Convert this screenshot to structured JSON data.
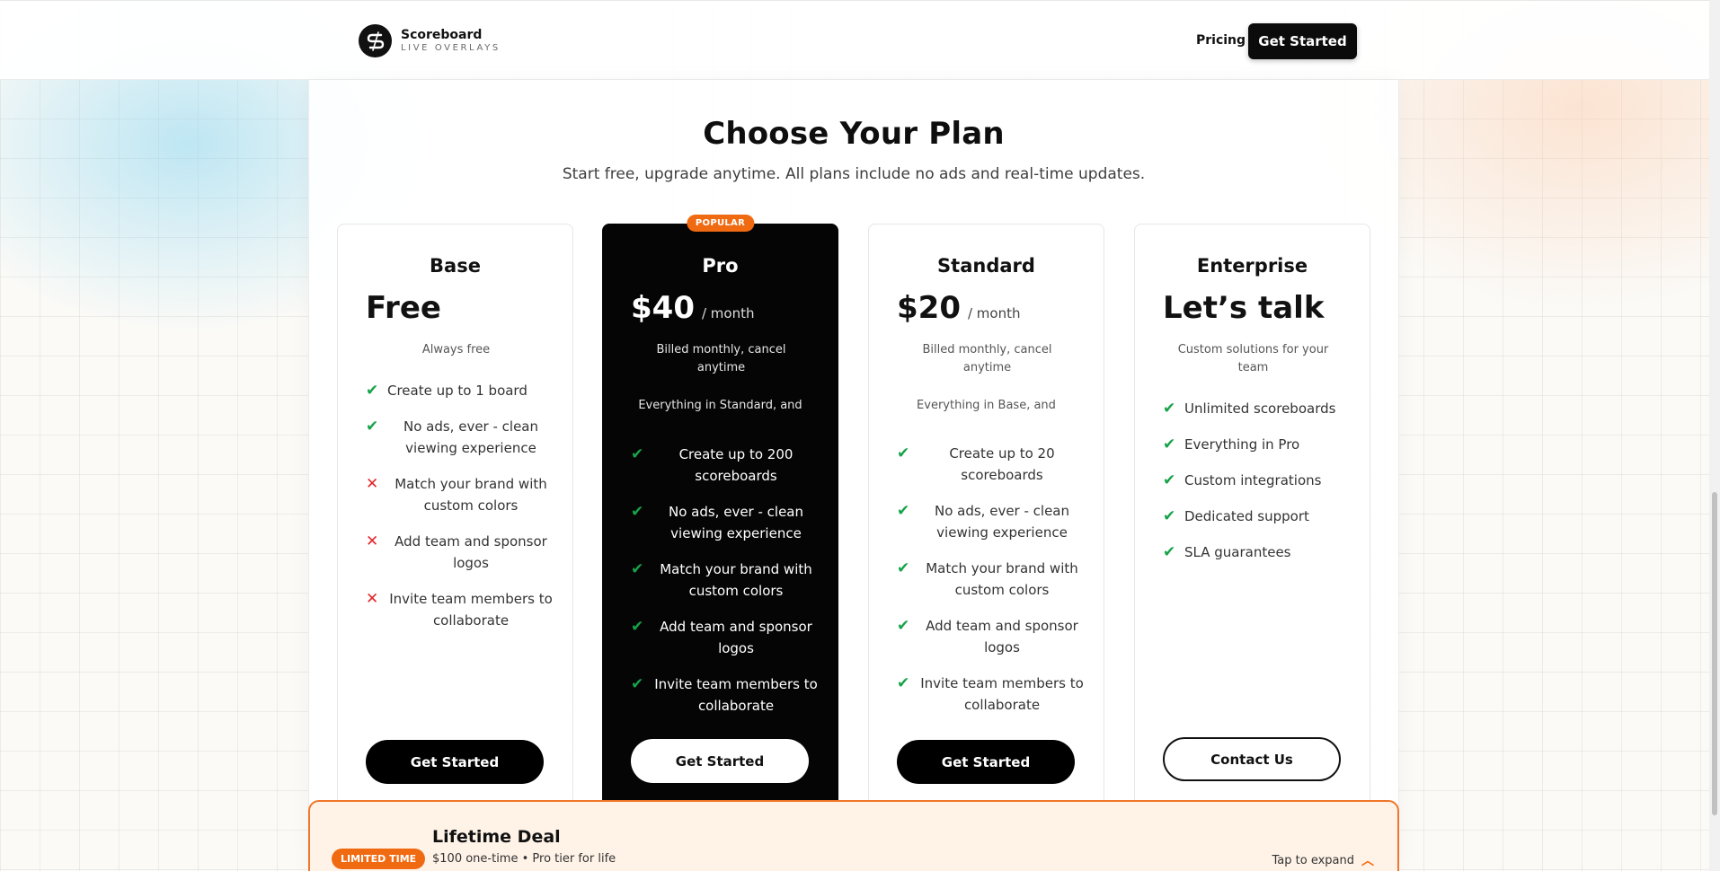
{
  "header": {
    "brand_name": "Scoreboard",
    "brand_tagline": "LIVE OVERLAYS",
    "nav_pricing": "Pricing",
    "cta": "Get Started"
  },
  "main": {
    "title": "Choose Your Plan",
    "subtitle": "Start free, upgrade anytime. All plans include no ads and real-time updates."
  },
  "plans": [
    {
      "name": "Base",
      "price": "Free",
      "billing": "Always free",
      "features": [
        {
          "text": "Create up to 1 board",
          "included": true,
          "icon": "check-icon"
        },
        {
          "text": "No ads, ever - clean viewing experience",
          "included": true,
          "icon": "check-icon"
        },
        {
          "text": "Match your brand with custom colors",
          "included": false,
          "icon": "cross-icon"
        },
        {
          "text": "Add team and sponsor logos",
          "included": false,
          "icon": "cross-icon"
        },
        {
          "text": "Invite team members to collaborate",
          "included": false,
          "icon": "cross-icon"
        }
      ],
      "button": "Get Started"
    },
    {
      "name": "Pro",
      "badge": "POPULAR",
      "price": "$40",
      "period": "/ month",
      "billing": "Billed monthly, cancel anytime",
      "everything": "Everything in Standard, and",
      "features": [
        {
          "text": "Create up to 200 scoreboards",
          "included": true,
          "icon": "check-icon"
        },
        {
          "text": "No ads, ever - clean viewing experience",
          "included": true,
          "icon": "check-icon"
        },
        {
          "text": "Match your brand with custom colors",
          "included": true,
          "icon": "check-icon"
        },
        {
          "text": "Add team and sponsor logos",
          "included": true,
          "icon": "check-icon"
        },
        {
          "text": "Invite team members to collaborate",
          "included": true,
          "icon": "check-icon"
        }
      ],
      "button": "Get Started"
    },
    {
      "name": "Standard",
      "price": "$20",
      "period": "/ month",
      "billing": "Billed monthly, cancel anytime",
      "everything": "Everything in Base, and",
      "features": [
        {
          "text": "Create up to 20 scoreboards",
          "included": true,
          "icon": "check-icon"
        },
        {
          "text": "No ads, ever - clean viewing experience",
          "included": true,
          "icon": "check-icon"
        },
        {
          "text": "Match your brand with custom colors",
          "included": true,
          "icon": "check-icon"
        },
        {
          "text": "Add team and sponsor logos",
          "included": true,
          "icon": "check-icon"
        },
        {
          "text": "Invite team members to collaborate",
          "included": true,
          "icon": "check-icon"
        }
      ],
      "button": "Get Started"
    },
    {
      "name": "Enterprise",
      "price": "Let’s talk",
      "billing": "Custom solutions for your team",
      "features": [
        {
          "text": "Unlimited scoreboards",
          "included": true,
          "icon": "check-icon"
        },
        {
          "text": "Everything in Pro",
          "included": true,
          "icon": "check-icon"
        },
        {
          "text": "Custom integrations",
          "included": true,
          "icon": "check-icon"
        },
        {
          "text": "Dedicated support",
          "included": true,
          "icon": "check-icon"
        },
        {
          "text": "SLA guarantees",
          "included": true,
          "icon": "check-icon"
        }
      ],
      "button": "Contact Us"
    }
  ],
  "deal": {
    "badge": "LIMITED TIME",
    "title": "Lifetime Deal",
    "subtitle": "$100 one-time • Pro tier for life",
    "expand_label": "Tap to expand",
    "expand_icon": "chevron-up-icon"
  },
  "colors": {
    "accent": "#f06a12",
    "check": "#17a34a",
    "cross": "#e5262a",
    "dark_card": "#050505"
  }
}
